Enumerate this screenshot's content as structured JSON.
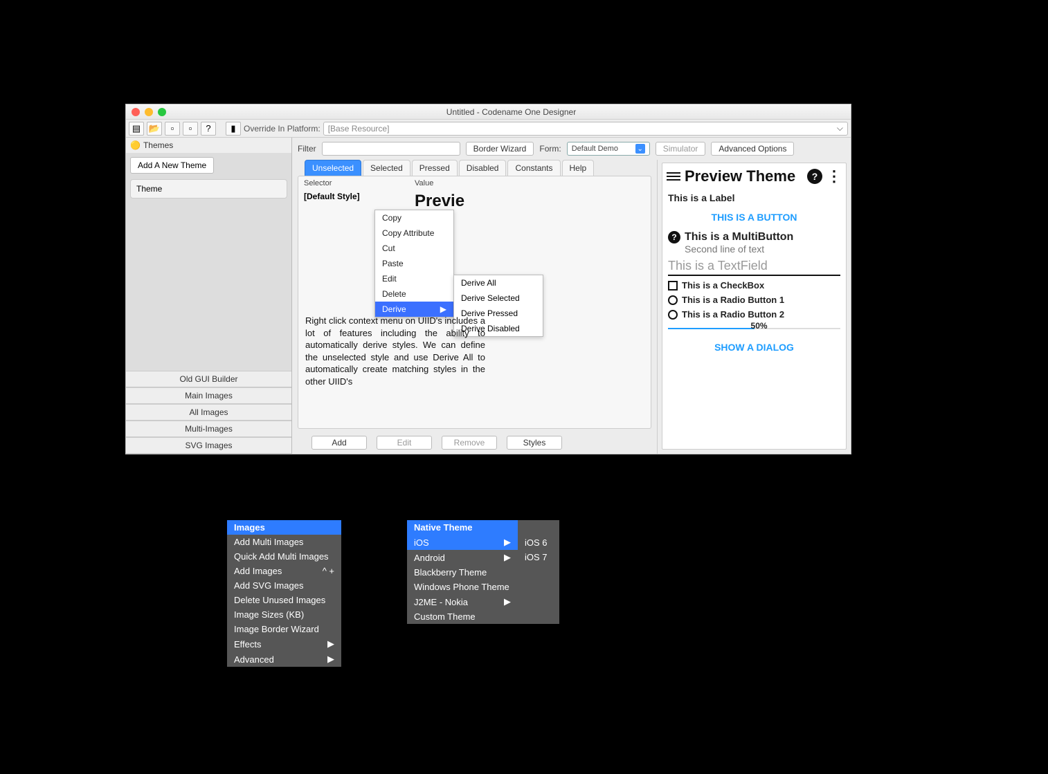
{
  "window": {
    "title": "Untitled - Codename One Designer",
    "override_label": "Override In Platform:",
    "override_combo": "[Base Resource]"
  },
  "left": {
    "section": "Themes",
    "add_theme": "Add A New Theme",
    "theme_item": "Theme",
    "cats": [
      "Old GUI Builder",
      "Main Images",
      "All Images",
      "Multi-Images",
      "SVG Images"
    ]
  },
  "center": {
    "filter_label": "Filter",
    "border_wizard": "Border Wizard",
    "form_label": "Form:",
    "form_value": "Default Demo",
    "simulator": "Simulator",
    "advanced": "Advanced Options",
    "tabs": [
      "Unselected",
      "Selected",
      "Pressed",
      "Disabled",
      "Constants",
      "Help"
    ],
    "col_selector": "Selector",
    "col_value": "Value",
    "default_style": "[Default Style]",
    "preview_word": "Previe",
    "context": [
      "Copy",
      "Copy Attribute",
      "Cut",
      "Paste",
      "Edit",
      "Delete",
      "Derive"
    ],
    "derive_sub": [
      "Derive All",
      "Derive Selected",
      "Derive Pressed",
      "Derive Disabled"
    ],
    "desc": "Right click context menu on UIID's includes a lot of features including the ability to automatically derive styles. We can define the unselected style and use Derive All to automatically create matching styles in the other UIID's",
    "buttons": [
      "Add",
      "Edit",
      "Remove",
      "Styles"
    ]
  },
  "preview": {
    "title": "Preview Theme",
    "label": "This is a Label",
    "button": "THIS IS A BUTTON",
    "multi_title": "This is a MultiButton",
    "multi_sub": "Second line of text",
    "textfield": "This is a TextField",
    "checkbox": "This is a CheckBox",
    "radio1": "This is a Radio Button 1",
    "radio2": "This is a Radio Button 2",
    "slider_pct": "50%",
    "dialog": "SHOW A DIALOG"
  },
  "images_popup": {
    "title": "Images",
    "items": [
      "Add Multi Images",
      "Quick Add Multi Images",
      "Add Images",
      "Add SVG Images",
      "Delete Unused Images",
      "Image Sizes (KB)",
      "Image Border Wizard",
      "Effects",
      "Advanced"
    ],
    "add_images_hint": "^ +"
  },
  "native_popup": {
    "title": "Native Theme",
    "items": [
      "iOS",
      "Android",
      "Blackberry Theme",
      "Windows Phone Theme",
      "J2ME - Nokia",
      "Custom Theme"
    ],
    "ios_sub": [
      "iOS 6",
      "iOS 7"
    ]
  }
}
